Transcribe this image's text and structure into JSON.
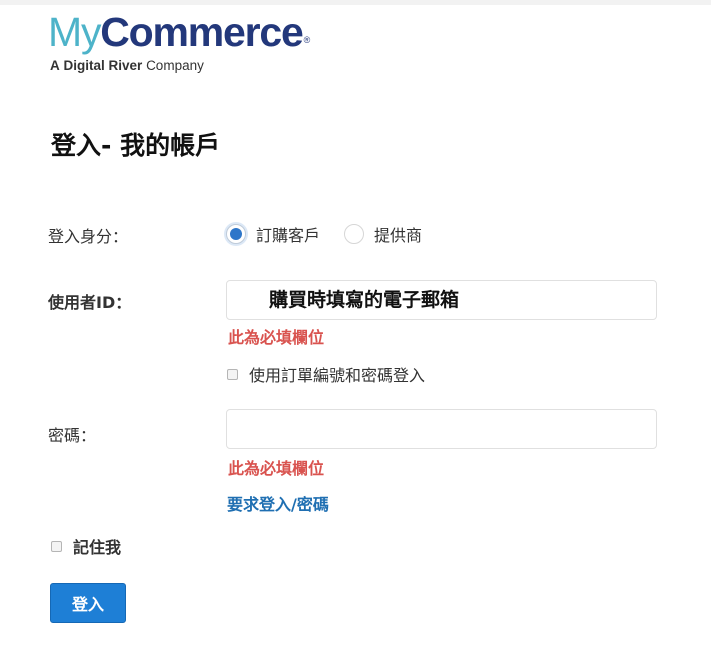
{
  "logo": {
    "my": "My",
    "commerce": "Commerce",
    "reg": "®",
    "sub_a": "A",
    "sub_brand": "Digital River",
    "sub_company": "Company"
  },
  "page_title": "登入- 我的帳戶",
  "login_type": {
    "label": "登入身分：",
    "options": [
      {
        "label": "訂購客戶",
        "selected": true
      },
      {
        "label": "提供商",
        "selected": false
      }
    ]
  },
  "user_id": {
    "label": "使用者ID：",
    "value": "購買時填寫的電子郵箱",
    "error": "此為必填欄位"
  },
  "order_login": {
    "label": "使用訂單編號和密碼登入",
    "checked": false
  },
  "password": {
    "label": "密碼：",
    "value": "",
    "error": "此為必填欄位",
    "request_link": "要求登入/密碼"
  },
  "remember": {
    "label": "記住我",
    "checked": false
  },
  "submit_label": "登入",
  "colors": {
    "brand_light": "#4db3c9",
    "brand_dark": "#23387b",
    "error": "#d9534f",
    "link": "#1f6fb2",
    "button": "#1e7fd6"
  }
}
